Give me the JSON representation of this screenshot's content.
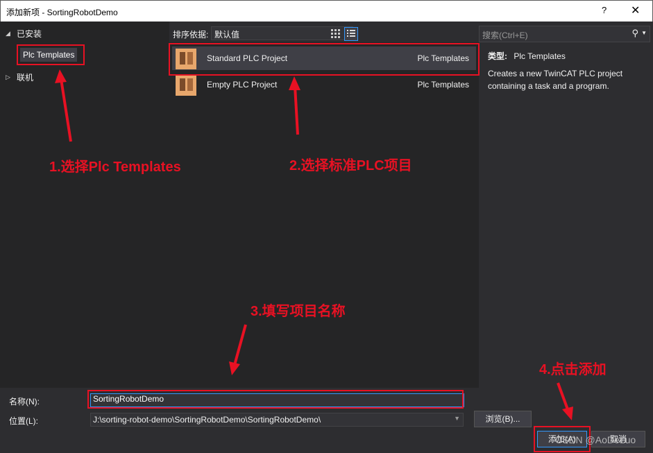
{
  "window": {
    "title": "添加新项 - SortingRobotDemo",
    "help": "?",
    "close": "✕"
  },
  "tree": {
    "installed": "已安装",
    "plc_templates": "Plc Templates",
    "online": "联机"
  },
  "toolbar": {
    "sort_label": "排序依据:",
    "sort_value": "默认值"
  },
  "templates": [
    {
      "name": "Standard PLC Project",
      "category": "Plc Templates"
    },
    {
      "name": "Empty PLC Project",
      "category": "Plc Templates"
    }
  ],
  "search": {
    "placeholder": "搜索(Ctrl+E)"
  },
  "details": {
    "type_label": "类型:",
    "type_value": "Plc Templates",
    "description": "Creates a new TwinCAT PLC project containing a task and a program."
  },
  "form": {
    "name_label": "名称(N):",
    "name_value": "SortingRobotDemo",
    "location_label": "位置(L):",
    "location_value": "J:\\sorting-robot-demo\\SortingRobotDemo\\SortingRobotDemo\\",
    "browse_button": "浏览(B)...",
    "add_button": "添加(A)",
    "cancel_button": "取消"
  },
  "annotations": {
    "step1": "1.选择Plc Templates",
    "step2": "2.选择标准PLC项目",
    "step3": "3.填写项目名称",
    "step4": "4.点击添加"
  },
  "watermark": "CSDN @AoDeLuo",
  "colors": {
    "accent": "#3399ff",
    "annotation": "#e81123"
  }
}
